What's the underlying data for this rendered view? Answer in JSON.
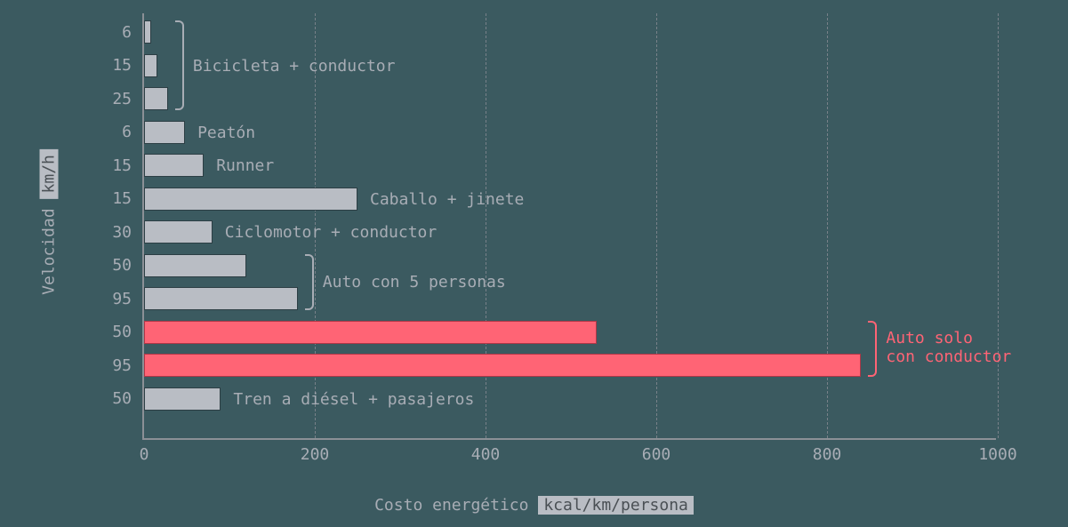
{
  "chart_data": {
    "type": "bar",
    "orientation": "horizontal",
    "xlabel": "Costo energético",
    "xunit": "kcal/km/persona",
    "ylabel": "Velocidad",
    "yunit": "km/h",
    "xlim": [
      0,
      1000
    ],
    "xticks": [
      0,
      200,
      400,
      600,
      800,
      1000
    ],
    "bars": [
      {
        "y_label": "6",
        "value": 8,
        "group": "Bicicleta + conductor",
        "highlight": false
      },
      {
        "y_label": "15",
        "value": 16,
        "group": "Bicicleta + conductor",
        "highlight": false
      },
      {
        "y_label": "25",
        "value": 28,
        "group": "Bicicleta + conductor",
        "highlight": false
      },
      {
        "y_label": "6",
        "value": 48,
        "group": "Peatón",
        "highlight": false
      },
      {
        "y_label": "15",
        "value": 70,
        "group": "Runner",
        "highlight": false
      },
      {
        "y_label": "15",
        "value": 250,
        "group": "Caballo + jinete",
        "highlight": false
      },
      {
        "y_label": "30",
        "value": 80,
        "group": "Ciclomotor + conductor",
        "highlight": false
      },
      {
        "y_label": "50",
        "value": 120,
        "group": "Auto con 5 personas",
        "highlight": false
      },
      {
        "y_label": "95",
        "value": 180,
        "group": "Auto con 5 personas",
        "highlight": false
      },
      {
        "y_label": "50",
        "value": 530,
        "group": "Auto solo con conductor",
        "highlight": true
      },
      {
        "y_label": "95",
        "value": 840,
        "group": "Auto solo con conductor",
        "highlight": true
      },
      {
        "y_label": "50",
        "value": 90,
        "group": "Tren a diésel + pasajeros",
        "highlight": false
      }
    ],
    "group_labels": [
      {
        "text": "Bicicleta + conductor",
        "bars": [
          0,
          1,
          2
        ],
        "bracket": true,
        "highlight": false
      },
      {
        "text": "Peatón",
        "bars": [
          3
        ],
        "bracket": false,
        "highlight": false
      },
      {
        "text": "Runner",
        "bars": [
          4
        ],
        "bracket": false,
        "highlight": false
      },
      {
        "text": "Caballo + jinete",
        "bars": [
          5
        ],
        "bracket": false,
        "highlight": false
      },
      {
        "text": "Ciclomotor + conductor",
        "bars": [
          6
        ],
        "bracket": false,
        "highlight": false
      },
      {
        "text": "Auto con 5 personas",
        "bars": [
          7,
          8
        ],
        "bracket": true,
        "highlight": false
      },
      {
        "text": "Auto solo con conductor",
        "bars": [
          9,
          10
        ],
        "bracket": true,
        "highlight": true,
        "two_line": true
      },
      {
        "text": "Tren a diésel + pasajeros",
        "bars": [
          11
        ],
        "bracket": false,
        "highlight": false
      }
    ]
  }
}
